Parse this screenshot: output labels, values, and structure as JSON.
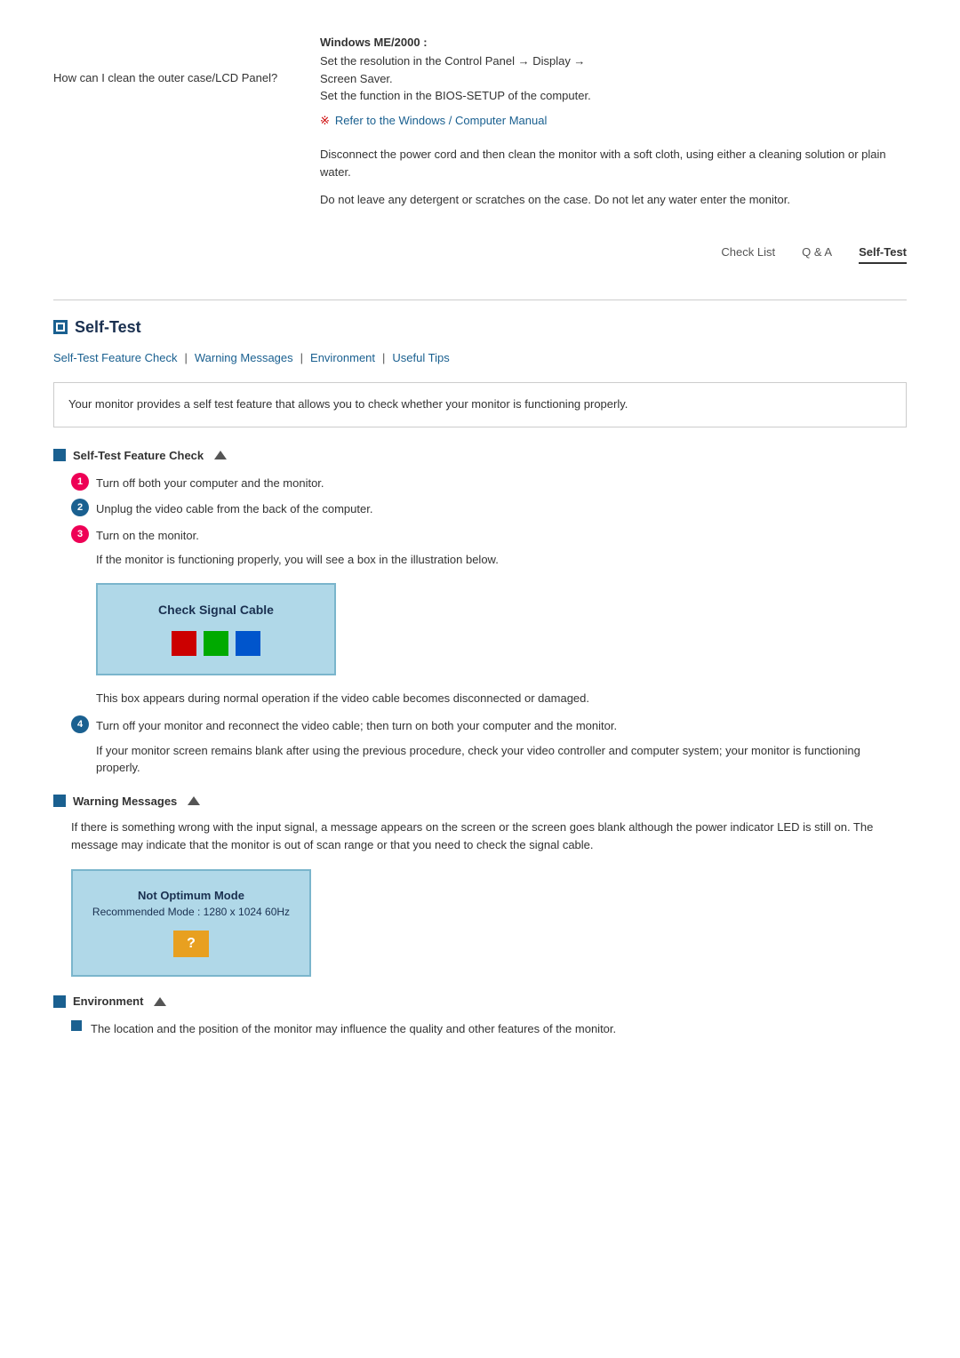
{
  "top": {
    "windows_label": "Windows ME/2000 :",
    "windows_text1": "Set the resolution in the Control Panel → Display →",
    "windows_text2": "Screen Saver.",
    "windows_text3": "Set the function in the BIOS-SETUP of the computer.",
    "refer_symbol": "※",
    "refer_text": "Refer to the Windows / Computer Manual",
    "question": "How can I clean the outer case/LCD Panel?",
    "answer1": "Disconnect the power cord and then clean the monitor with a soft cloth, using either a cleaning solution or plain water.",
    "answer2": "Do not leave any detergent or scratches on the case. Do not let any water enter the monitor."
  },
  "nav_tabs": {
    "items": [
      {
        "label": "Check List",
        "active": false
      },
      {
        "label": "Q & A",
        "active": false
      },
      {
        "label": "Self-Test",
        "active": true
      }
    ]
  },
  "self_test": {
    "heading": "Self-Test",
    "sub_nav": [
      {
        "label": "Self-Test Feature Check"
      },
      {
        "label": "Warning Messages"
      },
      {
        "label": "Environment"
      },
      {
        "label": "Useful Tips"
      }
    ],
    "info_box": "Your monitor provides a self test feature that allows you to check whether your monitor is functioning properly.",
    "feature_check": {
      "title": "Self-Test Feature Check",
      "steps": [
        {
          "num": "1",
          "text": "Turn off both your computer and the monitor."
        },
        {
          "num": "2",
          "text": "Unplug the video cable from the back of the computer."
        },
        {
          "num": "3",
          "text": "Turn on the monitor."
        }
      ],
      "step3_sub": "If the monitor is functioning properly, you will see a box in the illustration below.",
      "monitor_box": {
        "title": "Check Signal Cable",
        "squares": [
          {
            "color": "#cc0000"
          },
          {
            "color": "#00aa00"
          },
          {
            "color": "#0055cc"
          }
        ]
      },
      "box_note": "This box appears during normal operation if the video cable becomes disconnected or damaged.",
      "step4": {
        "num": "4",
        "text": "Turn off your monitor and reconnect the video cable; then turn on both your computer and the monitor."
      },
      "step4_sub": "If your monitor screen remains blank after using the previous procedure, check your video controller and computer system; your monitor is functioning properly."
    },
    "warning_messages": {
      "title": "Warning Messages",
      "text": "If there is something wrong with the input signal, a message appears on the screen or the screen goes blank although the power indicator LED is still on. The message may indicate that the monitor is out of scan range or that you need to check the signal cable.",
      "monitor_box": {
        "title": "Not Optimum Mode",
        "subtitle": "Recommended Mode : 1280 x 1024  60Hz",
        "question_mark": "?"
      }
    },
    "environment": {
      "title": "Environment",
      "item": "The location and the position of the monitor may influence the quality and other features of the monitor."
    }
  }
}
